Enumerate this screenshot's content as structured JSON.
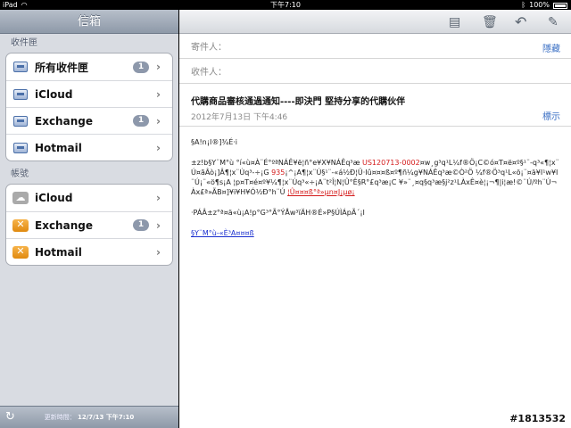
{
  "status_bar": {
    "device": "iPad",
    "time": "下午7:10",
    "battery": "100%"
  },
  "sidebar": {
    "title": "信箱",
    "inbox_section": "收件匣",
    "inboxes": [
      {
        "label": "所有收件匣",
        "badge": "1"
      },
      {
        "label": "iCloud",
        "badge": ""
      },
      {
        "label": "Exchange",
        "badge": "1"
      },
      {
        "label": "Hotmail",
        "badge": ""
      }
    ],
    "accounts_section": "帳號",
    "accounts": [
      {
        "label": "iCloud",
        "badge": ""
      },
      {
        "label": "Exchange",
        "badge": "1"
      },
      {
        "label": "Hotmail",
        "badge": ""
      }
    ],
    "footer_label": "更新時間：",
    "footer_time": "12/7/13 下午7:10"
  },
  "message": {
    "from_label": "寄件人：",
    "hide_label": "隱藏",
    "to_label": "收件人：",
    "subject": "代購商品審核通過通知----即決門 堅持分享的代購伙伴",
    "date": "2012年7月13日 下午4:46",
    "mark_label": "標示",
    "greeting": "§A!n¡I®]¾É·i",
    "p1_a": "±z!b§Y¨M°ù °í«ù¤À¨É°ºªNÁÊ¥ë¦ñ°e¥X¥NÁÊq³æ ",
    "p1_order": "US120713-0002",
    "p1_b": "¤w¸g³q¹L¼f®Ö¡C©ó¤T¤ë¤º§¹¨-q³«¶¦x¨Ú¤ãÂò¡]Â¶¦x¨Úq³-÷¡G ",
    "p1_num": "935",
    "p1_c": "¡^¡A¶¦x¨Ú§¹¨-«á½Ð¦Ü·Iû¤¤¤ß¤º¶ñ¼g¥NÁÊq³æ©Ò²Ö ¼f®Ö³q¹L«ö¡¨¤ä¥I¹w¥I¨Ú¡¨«ö¶s¡A ¦p¤T¤é¤º¥¼¶¦x¨Úq³«÷¡A¨t²Î¦N¦Û°Ê§R°£q³æ¡C ¥»¨¸¤q§q³æ§j²z¹LÀxÊ¤è¦¡¬¶|i¦æ!©¨Ú/ºh¨Ú¬Àx£ª»ÃB¤]¥i¥H¥Ó½Ð°h¨Ú ",
    "p1_link": "¦Û¤¤¤ß°ª»µn¤J¡µø¡",
    "p2": "·PÁÂ±z°ª¤ä«ù¡A!p°G³°Ã°ÝÅw³ïÄH®É»P§ÚÌÁpÃ´¡I",
    "sign_link": "§Y¨M°ù-«È³A¤¤¤ß"
  },
  "watermark": "#1813532"
}
